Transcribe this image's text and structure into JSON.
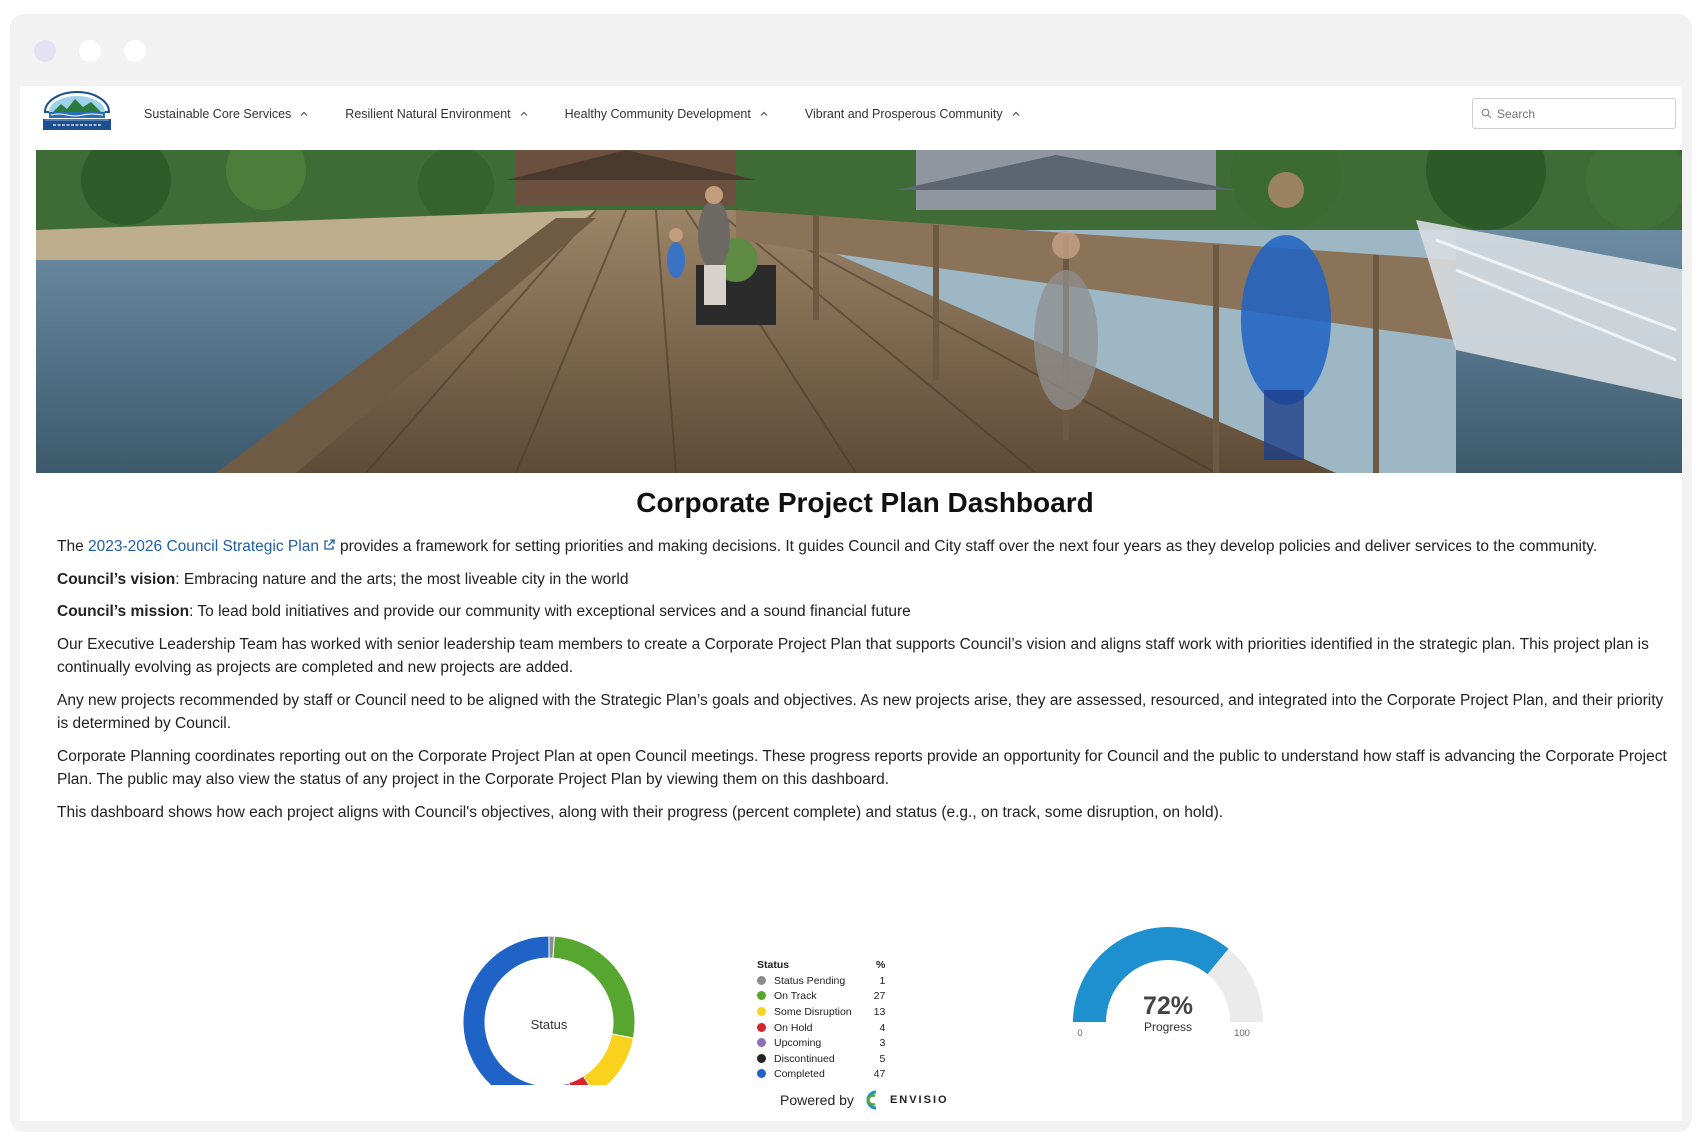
{
  "nav": {
    "items": [
      {
        "label": "Sustainable Core Services"
      },
      {
        "label": "Resilient Natural Environment"
      },
      {
        "label": "Healthy Community Development"
      },
      {
        "label": "Vibrant and Prosperous Community"
      }
    ],
    "search_placeholder": "Search"
  },
  "main": {
    "title": "Corporate Project Plan Dashboard",
    "intro_prefix": "The ",
    "intro_link": "2023-2026 Council Strategic Plan",
    "intro_suffix": "provides a framework for setting priorities and making decisions. It guides Council and City staff over the next four years as they develop policies and deliver services to the community.",
    "vision_label": "Council’s vision",
    "vision_text": ": Embracing nature and the arts; the most liveable city in the world",
    "mission_label": "Council’s mission",
    "mission_text": ": To lead bold initiatives and provide our community with exceptional services and a sound financial future",
    "paragraphs": [
      "Our Executive Leadership Team has worked with senior leadership team members to create a Corporate Project Plan that supports Council’s vision and aligns staff work with priorities identified in the strategic plan. This project plan is continually evolving as projects are completed and new projects are added.",
      "Any new projects recommended by staff or Council need to be aligned with the Strategic Plan’s goals and objectives. As new projects arise, they are assessed, resourced, and integrated into the Corporate Project Plan, and their priority is determined by Council.",
      "Corporate Planning coordinates reporting out on the Corporate Project Plan at open Council meetings. These progress reports provide an opportunity for Council and the public to understand how staff is advancing the Corporate Project Plan. The public may also view the status of any project in the Corporate Project Plan by viewing them on this dashboard.",
      "This dashboard shows how each project aligns with Council's objectives, along with their progress (percent complete) and status (e.g., on track, some disruption, on hold)."
    ]
  },
  "donut": {
    "center_label": "Status",
    "legend_header_status": "Status",
    "legend_header_pct": "%"
  },
  "gauge": {
    "value_label": "72%",
    "caption": "Progress",
    "min_label": "0",
    "max_label": "100"
  },
  "footer": {
    "powered_by": "Powered by",
    "brand": "ENVISIO"
  },
  "chart_data": [
    {
      "type": "pie",
      "title": "Status",
      "categories": [
        "Status Pending",
        "On Track",
        "Some Disruption",
        "On Hold",
        "Upcoming",
        "Discontinued",
        "Completed"
      ],
      "values": [
        1,
        27,
        13,
        4,
        3,
        5,
        47
      ],
      "colors": [
        "#8c8c8c",
        "#57a62f",
        "#f8d21d",
        "#d9232a",
        "#8a72b6",
        "#222222",
        "#1e63c5"
      ],
      "legend": "right"
    },
    {
      "type": "gauge",
      "value": 72,
      "min": 0,
      "max": 100,
      "colors": {
        "fill": "#1e8fcf",
        "track": "#ebebeb"
      }
    }
  ]
}
